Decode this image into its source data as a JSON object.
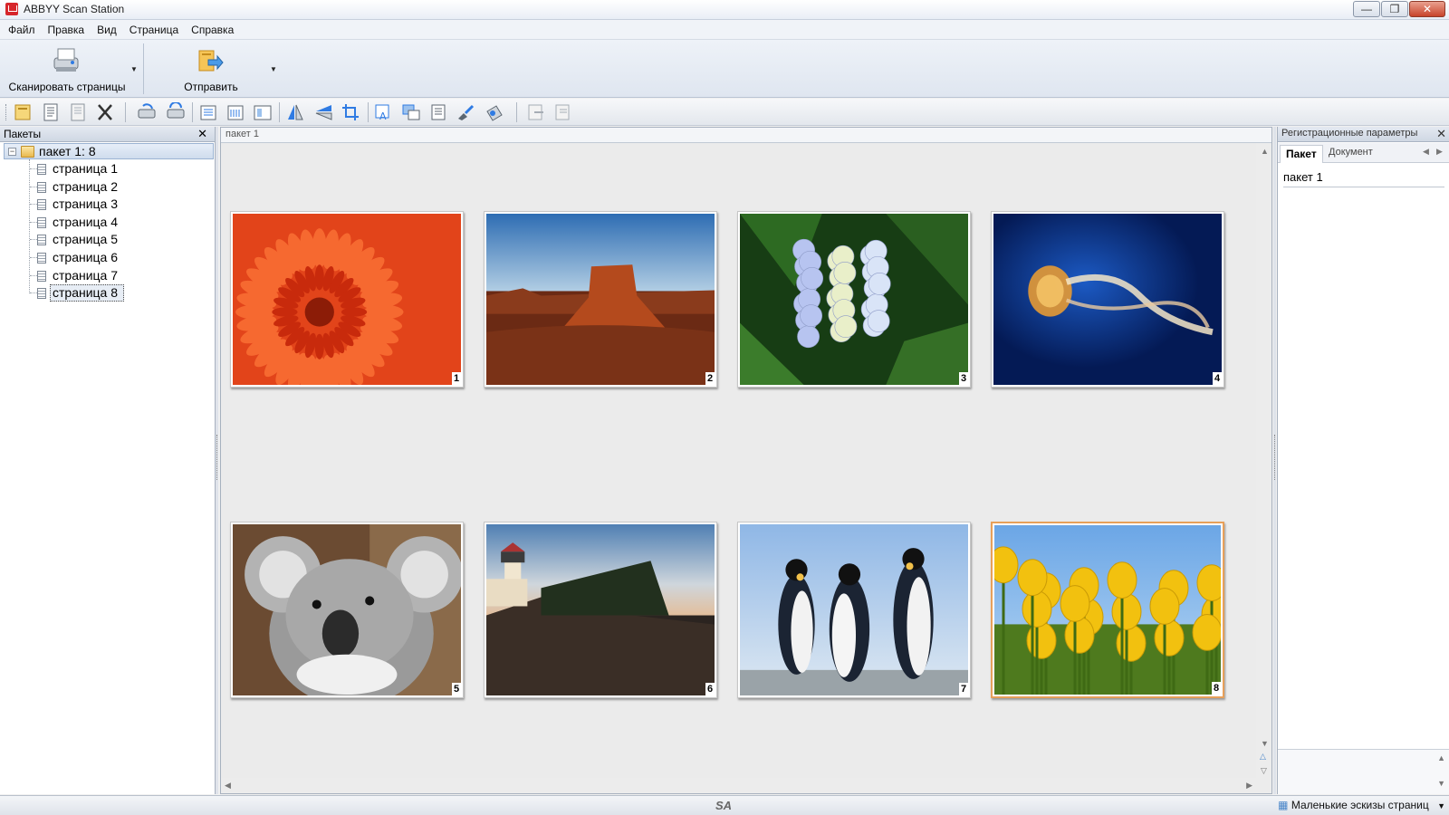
{
  "window": {
    "title": "ABBYY Scan Station"
  },
  "menu": [
    "Файл",
    "Правка",
    "Вид",
    "Страница",
    "Справка"
  ],
  "ribbon": {
    "scan_label": "Сканировать страницы",
    "send_label": "Отправить"
  },
  "toolbar": {
    "icons": [
      "new-batch-icon",
      "new-document-icon",
      "document-properties-icon",
      "delete-icon",
      "rescan-icon",
      "rotate-scan-icon",
      "split-page-icon",
      "merge-pages-icon",
      "page-layout-icon",
      "flip-vertical-icon",
      "flip-horizontal-icon",
      "crop-icon",
      "recognize-icon",
      "replace-icon",
      "properties-icon",
      "brush-icon",
      "clean-icon",
      "export-icon",
      "import-icon"
    ]
  },
  "left_panel": {
    "title": "Пакеты",
    "root": "пакет 1: 8",
    "pages": [
      "страница 1",
      "страница 2",
      "страница 3",
      "страница 4",
      "страница 5",
      "страница 6",
      "страница 7",
      "страница 8"
    ],
    "selected_index": 7
  },
  "center": {
    "breadcrumb": "пакет 1",
    "thumbnails": [
      {
        "num": "1",
        "name": "chrysanthemum"
      },
      {
        "num": "2",
        "name": "desert"
      },
      {
        "num": "3",
        "name": "hydrangeas"
      },
      {
        "num": "4",
        "name": "jellyfish"
      },
      {
        "num": "5",
        "name": "koala"
      },
      {
        "num": "6",
        "name": "lighthouse"
      },
      {
        "num": "7",
        "name": "penguins"
      },
      {
        "num": "8",
        "name": "tulips"
      }
    ],
    "selected_thumb": 7
  },
  "right_panel": {
    "title": "Регистрационные параметры",
    "tabs": [
      "Пакет",
      "Документ"
    ],
    "active_tab": 0,
    "field_value": "пакет 1"
  },
  "status": {
    "logo": "SA",
    "view_mode": "Маленькие эскизы страниц"
  },
  "colors": {
    "selection_border": "#e7a05a",
    "panel_border": "#a7b1bf"
  }
}
